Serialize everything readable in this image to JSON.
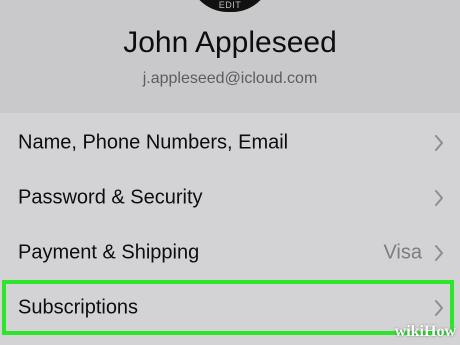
{
  "profile": {
    "avatar_edit_label": "EDIT",
    "name": "John Appleseed",
    "email": "j.appleseed@icloud.com"
  },
  "settings": {
    "items": [
      {
        "label": "Name, Phone Numbers, Email",
        "value": ""
      },
      {
        "label": "Password & Security",
        "value": ""
      },
      {
        "label": "Payment & Shipping",
        "value": "Visa"
      },
      {
        "label": "Subscriptions",
        "value": ""
      }
    ]
  },
  "highlight": {
    "item": "Subscriptions",
    "color": "#2ee52e"
  },
  "watermark": {
    "part1": "wiki",
    "part2": "How"
  },
  "icons": {
    "chevron": "chevron-right-icon"
  }
}
